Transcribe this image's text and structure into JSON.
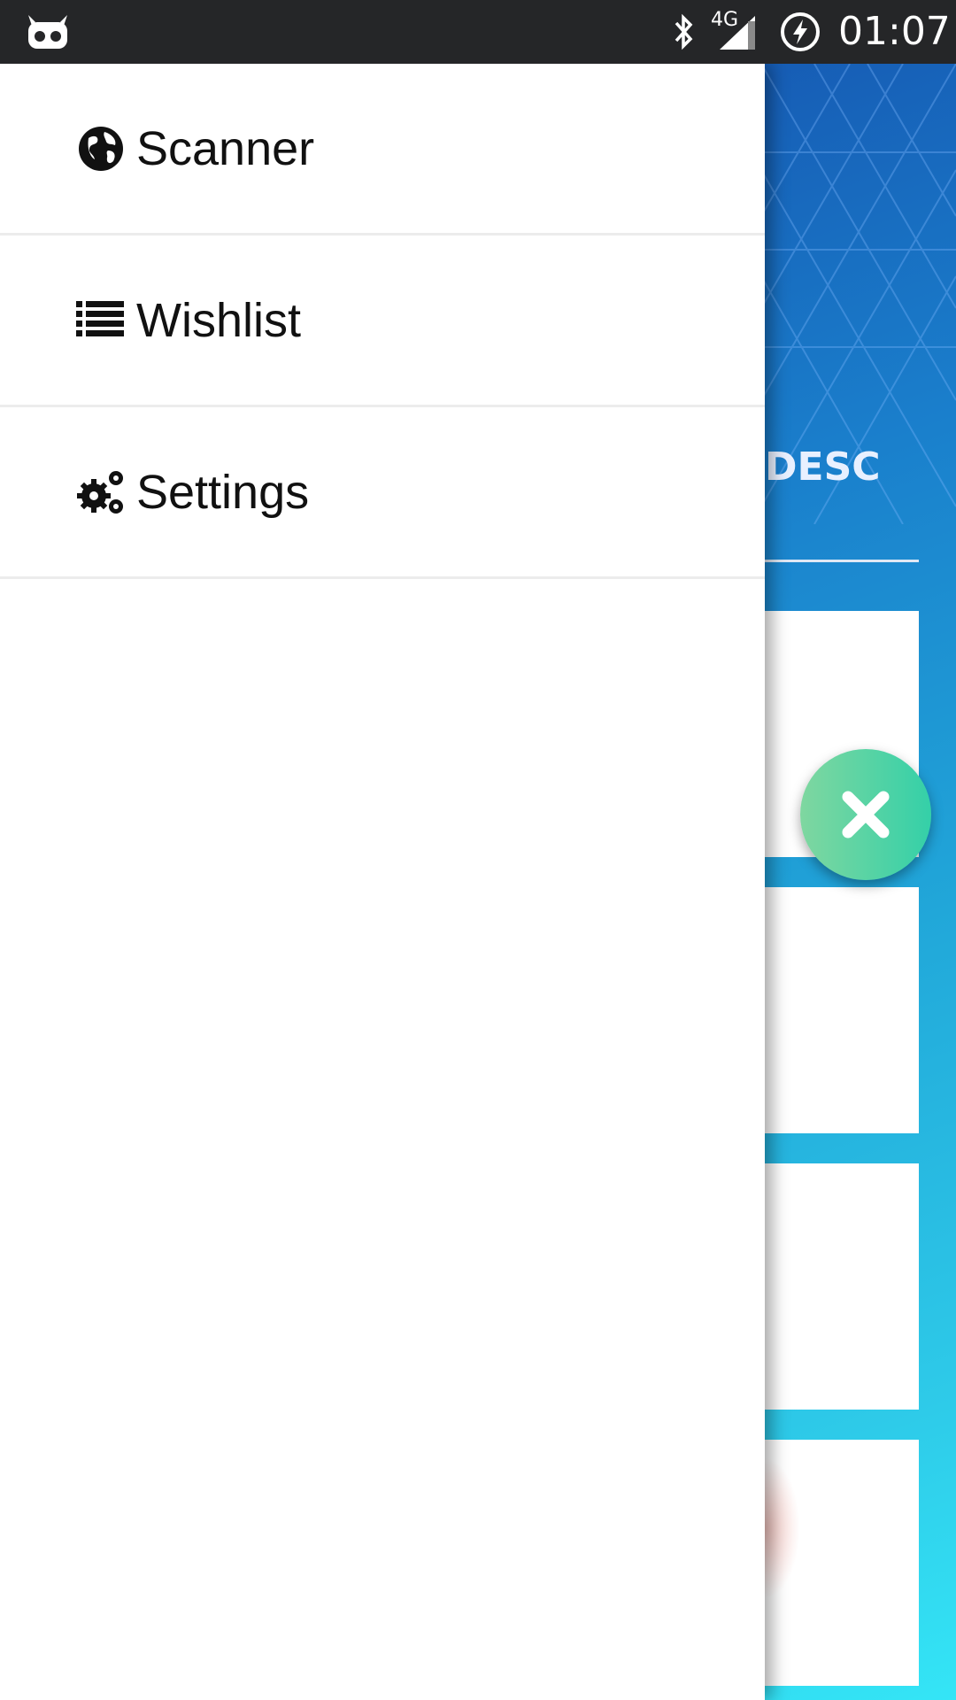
{
  "status_bar": {
    "network_type": "4G",
    "time": "01:07",
    "icons": [
      "robot-icon",
      "bluetooth-icon",
      "signal-icon",
      "battery-saver-icon"
    ]
  },
  "drawer": {
    "items": [
      {
        "label": "Scanner",
        "icon": "globe-icon"
      },
      {
        "label": "Wishlist",
        "icon": "list-icon"
      },
      {
        "label": "Settings",
        "icon": "gears-icon"
      }
    ]
  },
  "background": {
    "sort_label": "DESC",
    "fab_icon": "close-icon",
    "colors": {
      "gradient_top": "#1446a6",
      "gradient_bottom": "#34e5f6",
      "fab": "#34d0a8"
    }
  }
}
